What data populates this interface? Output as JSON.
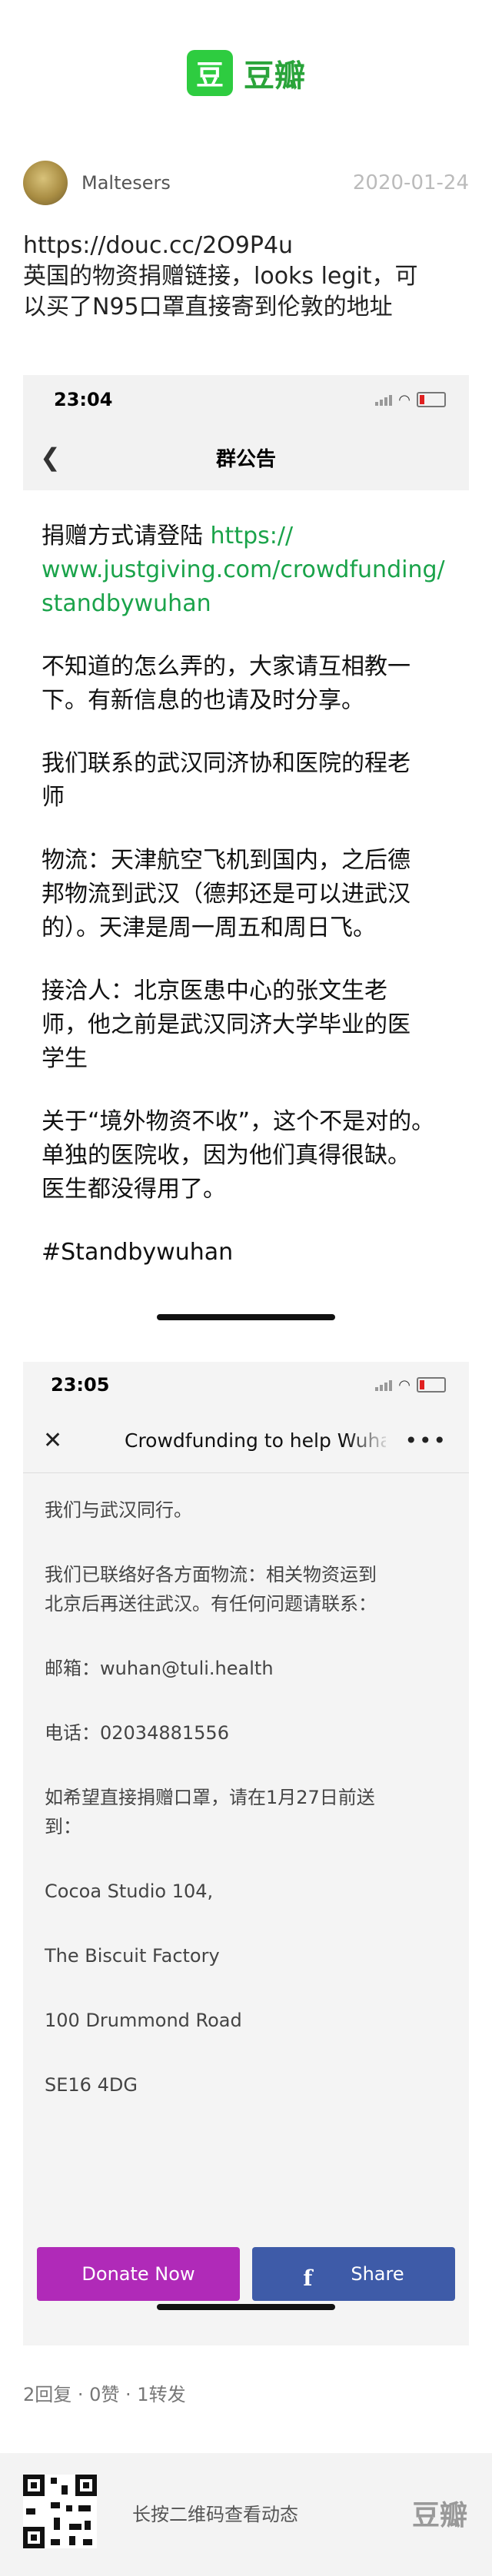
{
  "app": {
    "logo_glyph": "豆",
    "logo_text": "豆瓣",
    "brand_color": "#2ecc40"
  },
  "post": {
    "username": "Maltesers",
    "date": "2020-01-24",
    "lines": [
      "https://douc.cc/2O9P4u",
      "英国的物资捐赠链接，looks legit，可",
      "以买了N95口罩直接寄到伦敦的地址"
    ]
  },
  "screenshot1": {
    "time": "23:04",
    "back_icon": "chevron-left-icon",
    "title": "群公告",
    "donate_prefix": "捐赠方式请登陆 ",
    "link_lines": [
      "https://",
      "www.justgiving.com/crowdfunding/",
      "standbywuhan"
    ],
    "paragraphs": [
      [
        "不知道的怎么弄的，大家请互相教一",
        "下。有新信息的也请及时分享。"
      ],
      [
        "我们联系的武汉同济协和医院的程老",
        "师"
      ],
      [
        "物流：天津航空飞机到国内，之后德",
        "邦物流到武汉（德邦还是可以进武汉",
        "的）。天津是周一周五和周日飞。"
      ],
      [
        "接洽人：北京医患中心的张文生老",
        "师，他之前是武汉同济大学毕业的医",
        "学生"
      ],
      [
        "关于“境外物资不收”，这个不是对的。",
        "单独的医院收，因为他们真得很缺。",
        "医生都没得用了。"
      ],
      [
        "#Standbywuhan"
      ]
    ]
  },
  "screenshot2": {
    "time": "23:05",
    "close_icon": "close-icon",
    "title": "Crowdfunding to help Wuhan",
    "more_icon": "more-icon",
    "paragraphs": [
      [
        "我们与武汉同行。"
      ],
      [
        "我们已联络好各方面物流：相关物资运到",
        "北京后再送往武汉。有任何问题请联系："
      ],
      [
        "邮箱：wuhan@tuli.health"
      ],
      [
        "电话：02034881556"
      ],
      [
        "如希望直接捐赠口罩，请在1月27日前送",
        "到："
      ],
      [
        "Cocoa Studio 104,"
      ],
      [
        "The Biscuit Factory"
      ],
      [
        "100 Drummond Road"
      ],
      [
        "SE16 4DG"
      ]
    ],
    "donate_label": "Donate Now",
    "share_label": "Share",
    "donate_color": "#b02ab8",
    "share_color": "#3e5ba8"
  },
  "stats": "2回复 · 0赞 · 1转发",
  "footer": {
    "text": "长按二维码查看动态",
    "logo": "豆瓣"
  }
}
